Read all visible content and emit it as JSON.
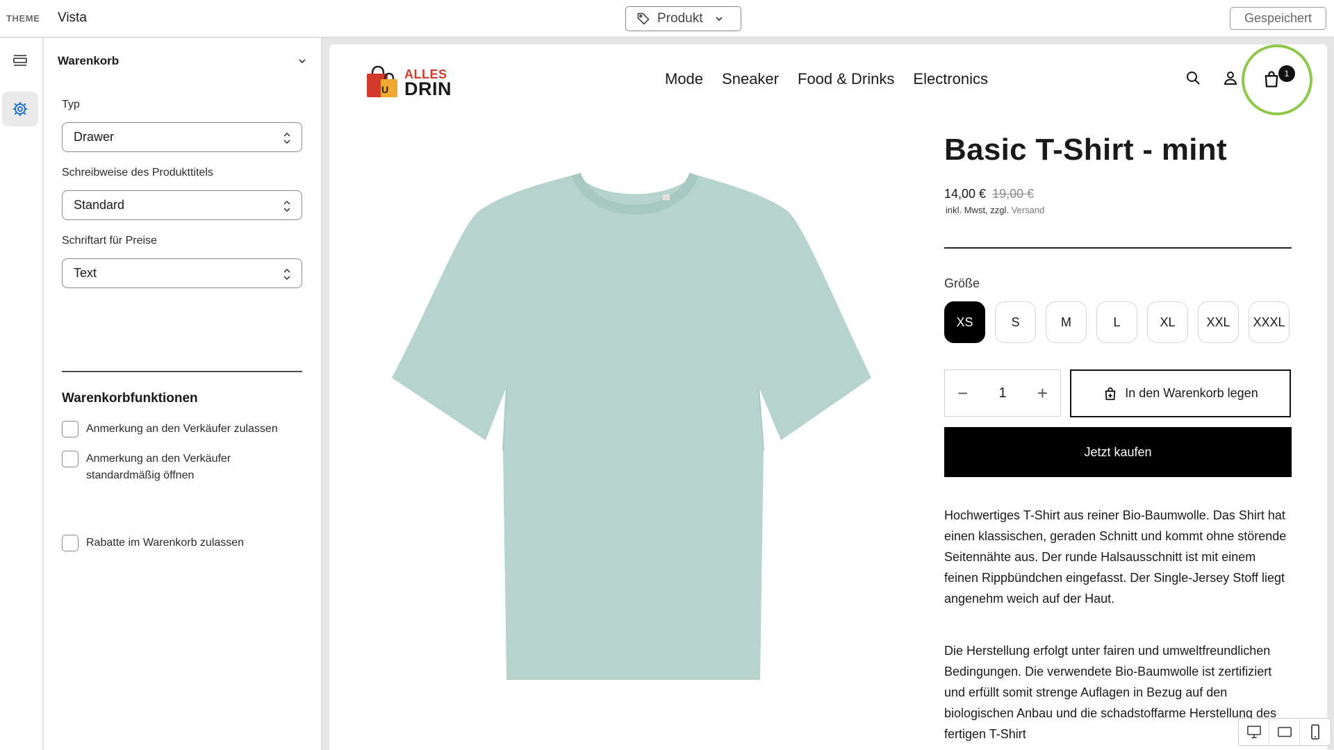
{
  "topbar": {
    "theme_label": "THEME",
    "theme_name": "Vista",
    "template_select": "Produkt",
    "saved_button": "Gespeichert"
  },
  "rail": {
    "items": [
      {
        "icon": "sections-icon"
      },
      {
        "icon": "gear-icon",
        "active": true
      }
    ]
  },
  "panel": {
    "title": "Warenkorb",
    "fields": [
      {
        "label": "Typ",
        "value": "Drawer"
      },
      {
        "label": "Schreibweise des Produkttitels",
        "value": "Standard"
      },
      {
        "label": "Schriftart für Preise",
        "value": "Text"
      }
    ],
    "section_title": "Warenkorbfunktionen",
    "checkboxes": [
      {
        "label": "Anmerkung an den Verkäufer zulassen",
        "checked": false
      },
      {
        "label": "Anmerkung an den Verkäufer standardmäßig öffnen",
        "checked": false
      },
      {
        "label": "Rabatte im Warenkorb zulassen",
        "checked": false
      }
    ]
  },
  "store": {
    "logo_top": "ALLES",
    "logo_bottom": "DRIN",
    "logo_bag_letter": "U",
    "nav": [
      "Mode",
      "Sneaker",
      "Food & Drinks",
      "Electronics"
    ],
    "cart_count": "1"
  },
  "product": {
    "title": "Basic T-Shirt - mint",
    "price": "14,00 €",
    "old_price": "19,00 €",
    "tax_note": "inkl. Mwst, zzgl.",
    "shipping_link": "Versand",
    "size_label": "Größe",
    "sizes": [
      "XS",
      "S",
      "M",
      "L",
      "XL",
      "XXL",
      "XXXL"
    ],
    "selected_size": "XS",
    "quantity": "1",
    "add_to_cart": "In den Warenkorb legen",
    "buy_now": "Jetzt kaufen",
    "description_1": "Hochwertiges T-Shirt aus reiner Bio-Baumwolle. Das Shirt hat einen klassischen, geraden Schnitt und kommt ohne störende Seitennähte aus. Der runde Halsausschnitt ist mit einem feinen Rippbündchen eingefasst. Der Single-Jersey Stoff liegt angenehm weich auf der Haut.",
    "description_2": "Die Herstellung erfolgt unter fairen und umweltfreundlichen Bedingungen. Die verwendete Bio-Baumwolle ist zertifiziert und erfüllt somit strenge Auflagen in Bezug auf den biologischen Anbau und die schadstoffarme Herstellung des fertigen T-Shirt"
  },
  "colors": {
    "accent": "#1f6fd1",
    "highlight_ring": "#8dc84a",
    "shirt": "#b6d4cd",
    "logo_red": "#d33a2c"
  }
}
